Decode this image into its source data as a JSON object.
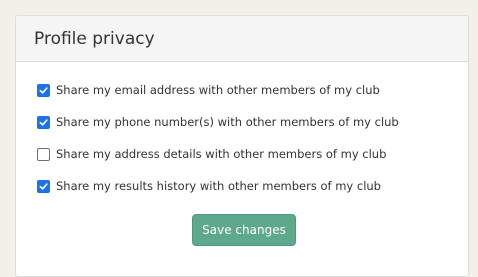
{
  "panel": {
    "title": "Profile privacy"
  },
  "options": [
    {
      "label": "Share my email address with other members of my club",
      "checked": true
    },
    {
      "label": "Share my phone number(s) with other members of my club",
      "checked": true
    },
    {
      "label": "Share my address details with other members of my club",
      "checked": false
    },
    {
      "label": "Share my results history with other members of my club",
      "checked": true
    }
  ],
  "save_button": {
    "label": "Save changes"
  },
  "colors": {
    "accent": "#1a73e8",
    "button": "#5ea98c"
  }
}
